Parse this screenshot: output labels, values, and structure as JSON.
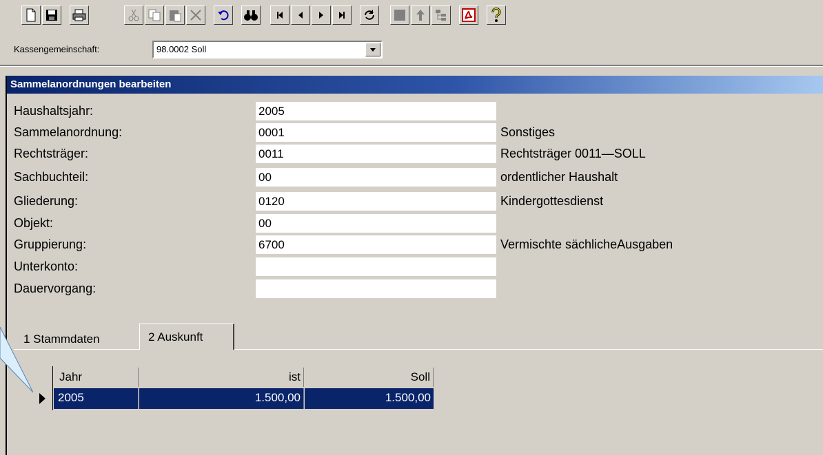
{
  "toolbar": {
    "buttons": [
      "new-document-icon",
      "save-icon",
      "print-icon",
      "cut-icon",
      "copy-icon",
      "paste-icon",
      "delete-icon",
      "undo-icon",
      "find-icon",
      "first-record-icon",
      "previous-record-icon",
      "next-record-icon",
      "last-record-icon",
      "refresh-icon",
      "stop-icon",
      "up-arrow-icon",
      "tree-icon",
      "pdf-icon",
      "help-icon"
    ]
  },
  "combo": {
    "label": "Kassengemeinschaft:",
    "value": "98.0002  Soll"
  },
  "panel": {
    "title": "Sammelanordnungen bearbeiten"
  },
  "form": {
    "rows": [
      {
        "label": "Haushaltsjahr:",
        "value": "2005",
        "desc": ""
      },
      {
        "label": "Sammelanordnung:",
        "value": "0001",
        "desc": "Sonstiges"
      },
      {
        "label": "Rechtsträger:",
        "value": "0011",
        "desc": "Rechtsträger 0011—SOLL"
      },
      {
        "label": "Sachbuchteil:",
        "value": "00",
        "desc": "ordentlicher Haushalt"
      },
      {
        "label": "Gliederung:",
        "value": "0120",
        "desc": "Kindergottesdienst"
      },
      {
        "label": "Objekt:",
        "value": "00",
        "desc": ""
      },
      {
        "label": "Gruppierung:",
        "value": "6700",
        "desc": "Vermischte sächlicheAusgaben"
      },
      {
        "label": "Unterkonto:",
        "value": "",
        "desc": ""
      },
      {
        "label": "Dauervorgang:",
        "value": "",
        "desc": ""
      }
    ]
  },
  "tabs": [
    {
      "label": "1 Stammdaten"
    },
    {
      "label": "2 Auskunft"
    }
  ],
  "grid": {
    "columns": [
      "Jahr",
      "ist",
      "Soll"
    ],
    "rows": [
      {
        "jahr": "2005",
        "ist": "1.500,00",
        "soll": "1.500,00"
      }
    ]
  },
  "colors": {
    "selection": "#0a246a",
    "background": "#d4d0c8",
    "titlebar_start": "#0a246a",
    "titlebar_end": "#a6c8f0"
  }
}
